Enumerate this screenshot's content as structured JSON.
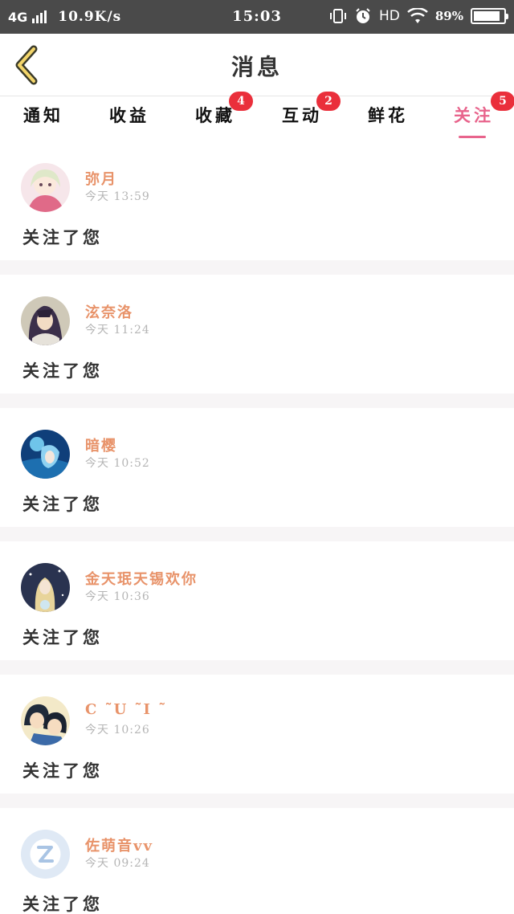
{
  "status_bar": {
    "network": "4G",
    "speed": "10.9K/s",
    "time": "15:03",
    "hd": "HD",
    "battery_percent": "89%",
    "battery_level": 0.89
  },
  "header": {
    "title": "消息",
    "back_icon": "chevron-left-icon",
    "accent_color": "#e8648c",
    "name_color": "#e8936a",
    "badge_color": "#ea2f3b"
  },
  "tabs": [
    {
      "label": "通知",
      "badge": ""
    },
    {
      "label": "收益",
      "badge": ""
    },
    {
      "label": "收藏",
      "badge": "4"
    },
    {
      "label": "互动",
      "badge": "2"
    },
    {
      "label": "鲜花",
      "badge": ""
    },
    {
      "label": "关注",
      "badge": "5"
    }
  ],
  "active_tab": "关注",
  "messages": [
    {
      "name": "弥月",
      "time": "今天 13:59",
      "text": "关注了您",
      "avatar": "anime-girl-pink-avatar"
    },
    {
      "name": "泫奈洛",
      "time": "今天 11:24",
      "text": "关注了您",
      "avatar": "anime-dark-hair-avatar"
    },
    {
      "name": "暗樱",
      "time": "今天 10:52",
      "text": "关注了您",
      "avatar": "anime-blue-ocean-avatar"
    },
    {
      "name": "金天珉天锡欢你",
      "time": "今天 10:36",
      "text": "关注了您",
      "avatar": "anime-blonde-night-avatar"
    },
    {
      "name": "C ˜U ˜I ˜",
      "time": "今天 10:26",
      "text": "关注了您",
      "avatar": "anime-couple-avatar"
    },
    {
      "name": "佐萌音vv",
      "time": "今天 09:24",
      "text": "关注了您",
      "avatar": "default-qq-avatar"
    }
  ]
}
